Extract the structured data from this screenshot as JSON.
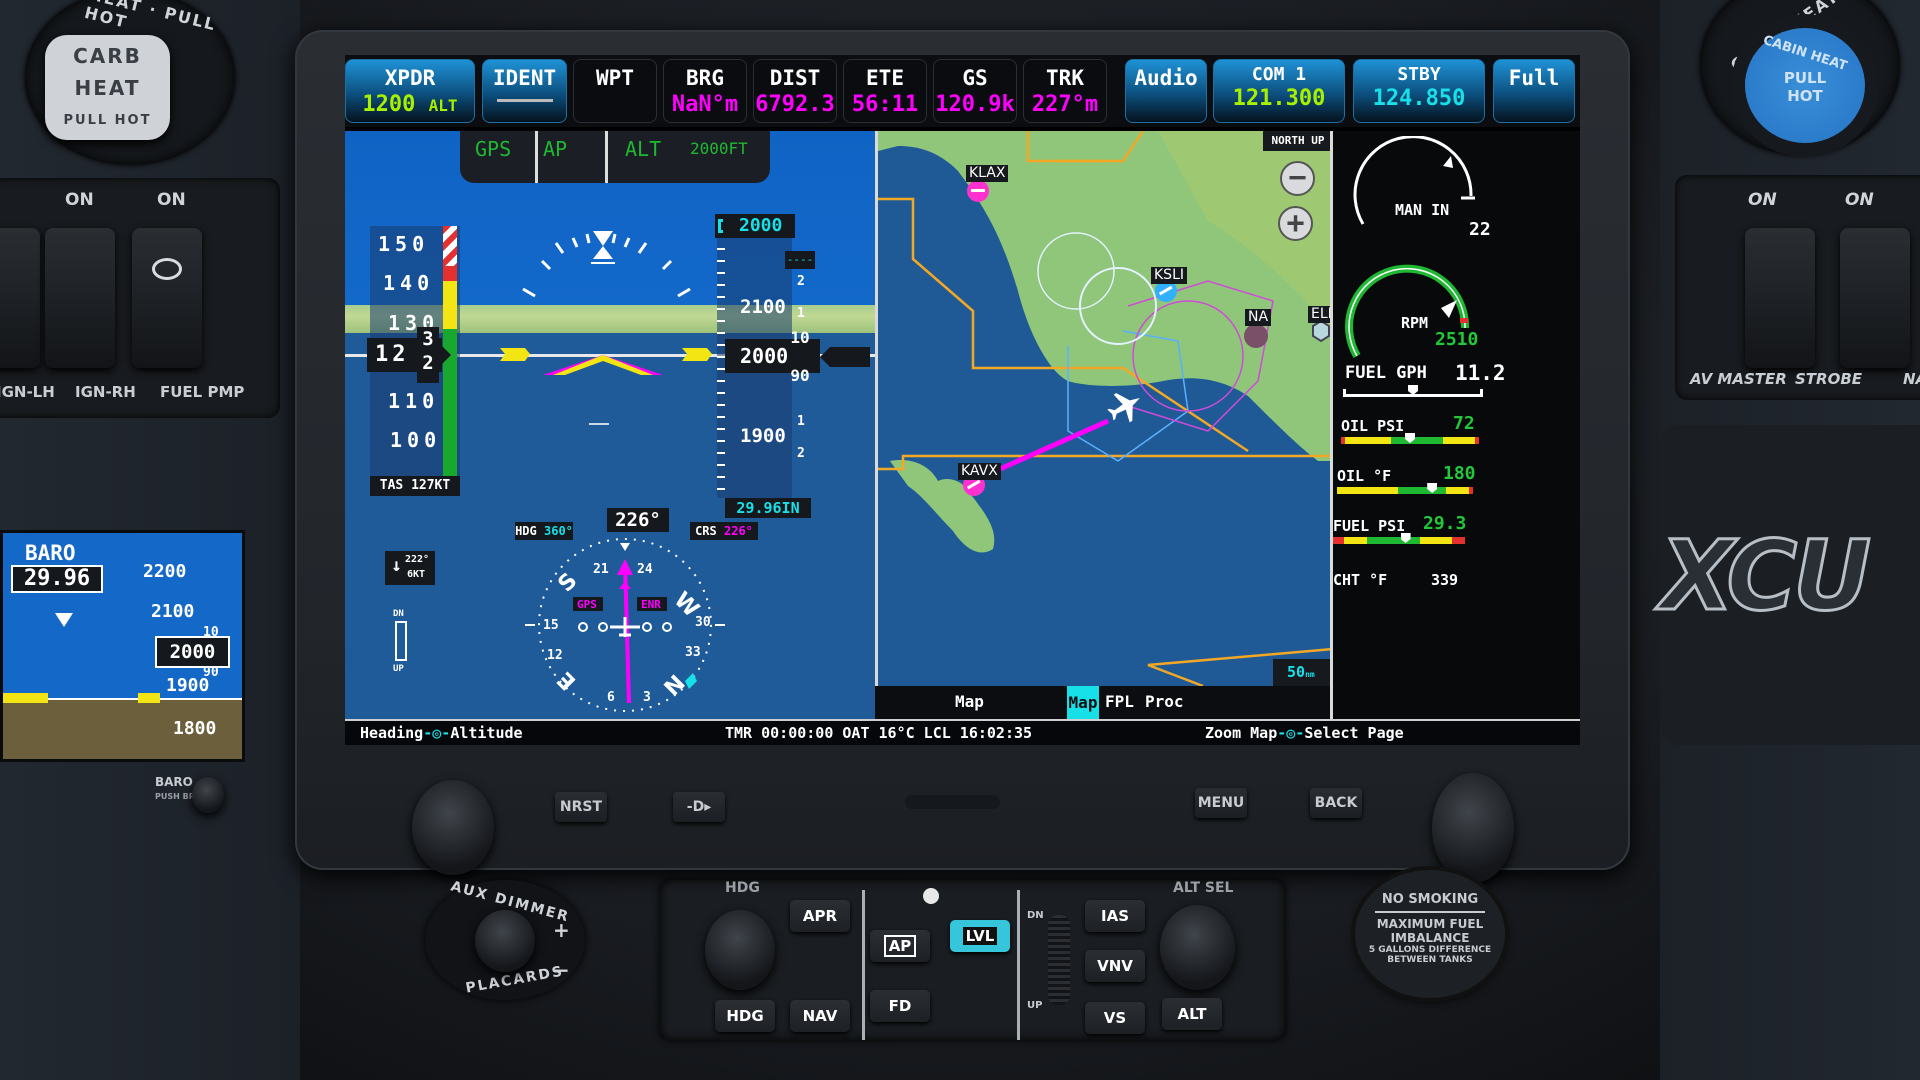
{
  "cockpit": {
    "carb_heat": {
      "ring": "HEAT · PULL HOT",
      "line1": "CARB",
      "line2": "HEAT",
      "line3": "PULL  HOT"
    },
    "left_switches": [
      {
        "label": "IGN-LH",
        "on": ""
      },
      {
        "label": "IGN-RH",
        "on": "ON"
      },
      {
        "label": "FUEL PMP",
        "on": "ON"
      }
    ],
    "cabin_heat": {
      "ring": "CABIN HEAT · PULL",
      "line1": "CABIN HEAT",
      "line2": "PULL",
      "line3": "HOT"
    },
    "right_switches": [
      {
        "label": "AV MASTER",
        "on": "ON"
      },
      {
        "label": "STROBE",
        "on": "ON"
      },
      {
        "label": "NA",
        "on": ""
      }
    ],
    "brand": "XCU",
    "aux_dimmer": {
      "top": "AUX DIMMER",
      "bottom": "PLACARDS",
      "plus": "+",
      "minus": "−"
    },
    "placard": {
      "line1": "NO SMOKING",
      "line2": "MAXIMUM FUEL",
      "line3": "IMBALANCE",
      "line4": "5 GALLONS DIFFERENCE",
      "line5": "BETWEEN TANKS"
    }
  },
  "standby_pfd": {
    "baro_label": "BARO",
    "baro_value": "29.96",
    "alt_ticks": [
      "2200",
      "2100",
      "1900",
      "1800"
    ],
    "alt_current": "2000",
    "alt_roll_up": "10",
    "alt_roll_down": "90",
    "knob_label": "BARO",
    "knob_sub": "PUSH BR"
  },
  "topbar": {
    "xpdr": {
      "label": "XPDR",
      "code": "1200",
      "mode": "ALT"
    },
    "ident": {
      "label": "IDENT"
    },
    "fields": [
      {
        "label": "WPT",
        "value": ""
      },
      {
        "label": "BRG",
        "value": "NaN°m"
      },
      {
        "label": "DIST",
        "value": "6792.3"
      },
      {
        "label": "ETE",
        "value": "56:11"
      },
      {
        "label": "GS",
        "value": "120.9k"
      },
      {
        "label": "TRK",
        "value": "227°m"
      }
    ],
    "audio": {
      "label": "Audio"
    },
    "com1": {
      "label": "COM 1",
      "value": "121.300"
    },
    "stby": {
      "label": "STBY",
      "value": "124.850"
    },
    "full": {
      "label": "Full"
    }
  },
  "pfd": {
    "ap_modes": {
      "lateral": "GPS",
      "ap": "AP",
      "vertical": "ALT",
      "target": "2000FT"
    },
    "airspeed": {
      "ticks": [
        "150",
        "140",
        "130",
        "110",
        "100"
      ],
      "current": "12",
      "roll_up": "3",
      "roll_down": "2",
      "tas": "TAS  127KT"
    },
    "altitude": {
      "selected": "2000",
      "ticks": [
        "2100",
        "1900"
      ],
      "current": "2000",
      "roll_up": "10",
      "roll_down": "90",
      "baro": "29.96IN",
      "vs_ticks": [
        "2",
        "1",
        "1",
        "2"
      ],
      "vs_box": "----"
    },
    "hsi": {
      "heading": "226°",
      "hdg_label": "HDG",
      "hdg_bug": "360°",
      "crs_label": "CRS",
      "crs_value": "226°",
      "nav_source": "GPS",
      "phase": "ENR",
      "cardinal": [
        "S",
        "W",
        "N",
        "E"
      ],
      "numbers": [
        "21",
        "24",
        "30",
        "33",
        "3",
        "6",
        "12",
        "15"
      ]
    },
    "wind": {
      "direction": "222°",
      "speed": "6KT"
    },
    "trim": {
      "dn": "DN",
      "up": "UP"
    }
  },
  "map": {
    "orientation": "NORTH UP",
    "zoom_out": "−",
    "zoom_in": "+",
    "airports": [
      "KLAX",
      "KSLI",
      "NA",
      "ELB",
      "KAVX"
    ],
    "scale": "50",
    "scale_unit": "nm",
    "tabs": [
      {
        "label": "Map",
        "active": false
      },
      {
        "label": "Map",
        "active": true
      },
      {
        "label": "FPL",
        "active": false
      },
      {
        "label": "Proc",
        "active": false
      }
    ]
  },
  "eis": {
    "man_in": {
      "label": "MAN IN",
      "value": "22"
    },
    "rpm": {
      "label": "RPM",
      "value": "2510"
    },
    "fuel_gph": {
      "label": "FUEL GPH",
      "value": "11.2",
      "fraction": 0.5
    },
    "oil_psi": {
      "label": "OIL PSI",
      "value": "72",
      "fraction": 0.5
    },
    "oil_f": {
      "label": "OIL °F",
      "value": "180",
      "fraction": 0.7
    },
    "fuel_psi": {
      "label": "FUEL PSI",
      "value": "29.3",
      "fraction": 0.55
    },
    "cht": {
      "label": "CHT °F",
      "value": "339"
    }
  },
  "statusbar": {
    "left_a": "Heading",
    "left_b": "Altitude",
    "center": "TMR 00:00:00 OAT 16°C LCL 16:02:35",
    "right_a": "Zoom Map",
    "right_b": "Select Page"
  },
  "bezel_buttons": {
    "nrst": "NRST",
    "direct": "-D▸",
    "menu": "MENU",
    "back": "BACK"
  },
  "autopilot": {
    "hdg_header": "HDG",
    "alt_header": "ALT SEL",
    "buttons": {
      "apr": "APR",
      "hdg": "HDG",
      "nav": "NAV",
      "ap": "AP",
      "fd": "FD",
      "lvl": "LVL",
      "ias": "IAS",
      "vnv": "VNV",
      "vs": "VS",
      "alt": "ALT"
    },
    "trim_dn": "DN",
    "trim_up": "UP"
  },
  "colors": {
    "magenta": "#ff00ff",
    "cyan": "#18e0e8",
    "green": "#22c83a",
    "lime": "#a8f000",
    "button_blue": "#1f92d6",
    "lvl_active": "#36c6dc"
  }
}
